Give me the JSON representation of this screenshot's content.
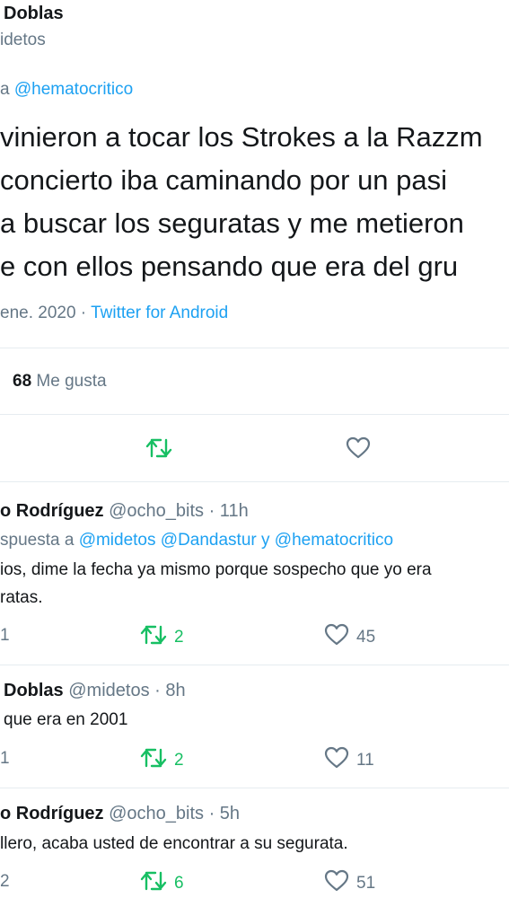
{
  "main_tweet": {
    "author_name": "Doblas",
    "author_handle": "idetos",
    "reply_to_prefix": "a",
    "reply_to_mention": "@hematocritico",
    "lines": [
      "vinieron a tocar los Strokes a la Razzm",
      "concierto iba caminando por un pasi",
      "a buscar los seguratas y me metieron",
      "e con ellos pensando que era del gru"
    ],
    "date": "ene. 2020 ·",
    "source": "Twitter for Android",
    "likes_count": "68",
    "likes_label": "Me gusta"
  },
  "replies": [
    {
      "name": "o Rodríguez",
      "handle_time": "@ocho_bits · 11h",
      "reply_prefix": "spuesta a",
      "mentions": "@midetos @Dandastur y @hematocritico",
      "lines": [
        "ios, dime la fecha ya mismo porque sospecho que yo era",
        "ratas."
      ],
      "reply_count": "1",
      "retweet_count": "2",
      "like_count": "45"
    },
    {
      "name": "Doblas",
      "handle_time": "@midetos · 8h",
      "lines": [
        "que era en 2001"
      ],
      "reply_count": "1",
      "retweet_count": "2",
      "like_count": "11"
    },
    {
      "name": "o Rodríguez",
      "handle_time": "@ocho_bits · 5h",
      "lines": [
        "llero, acaba usted de encontrar a su segurata."
      ],
      "reply_count": "2",
      "retweet_count": "6",
      "like_count": "51"
    }
  ],
  "colors": {
    "text": "#14171a",
    "muted": "#657786",
    "link": "#1da1f2",
    "retweet_green": "#17bf63",
    "separator": "#e6ecf0"
  },
  "icons": {
    "retweet": "retweet-icon",
    "like": "heart-icon",
    "reply": "reply-icon"
  }
}
